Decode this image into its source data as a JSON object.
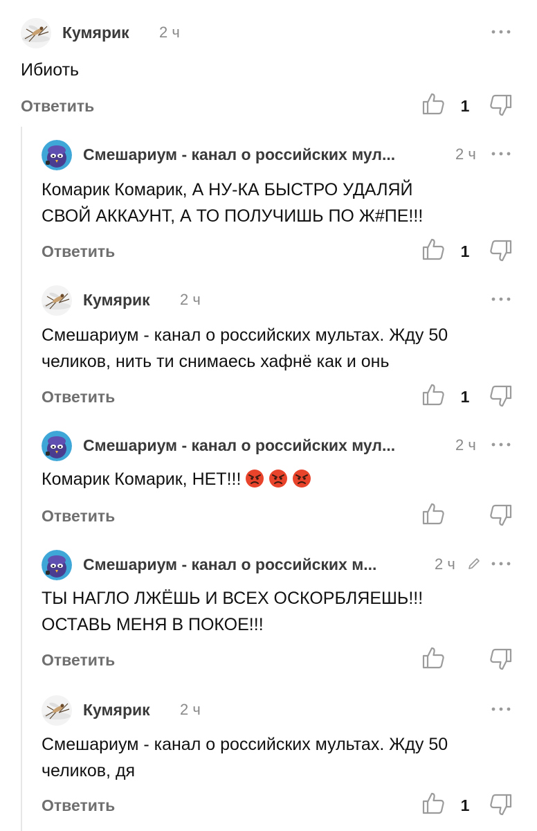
{
  "comments": [
    {
      "author": "Кумярик",
      "time": "2 ч",
      "text": "Ибиоть",
      "reply_label": "Ответить",
      "likes": "1"
    },
    {
      "author": "Смешариум - канал о российских мул...",
      "time": "2 ч",
      "text_lines": [
        "Комарик Комарик, А НУ-КА БЫСТРО УДАЛЯЙ",
        "СВОЙ АККАУНТ, А ТО ПОЛУЧИШЬ ПО Ж#ПЕ!!!"
      ],
      "reply_label": "Ответить",
      "likes": "1"
    },
    {
      "author": "Кумярик",
      "time": "2 ч",
      "text_lines": [
        "Смешариум - канал о российских мультах. Жду 50",
        "челиков, нить ти снимаесь хафнё как и онь"
      ],
      "reply_label": "Ответить",
      "likes": "1"
    },
    {
      "author": "Смешариум - канал о российских мул...",
      "time": "2 ч",
      "text": "Комарик Комарик, НЕТ!!!",
      "emojis": [
        "angry-face",
        "angry-face",
        "angry-face"
      ],
      "reply_label": "Ответить",
      "likes": ""
    },
    {
      "author": "Смешариум - канал о российских м...",
      "time": "2 ч",
      "edited_icon": "pencil-icon",
      "text_lines": [
        "ТЫ НАГЛО ЛЖЁШЬ И ВСЕХ ОСКОРБЛЯЕШЬ!!!",
        "ОСТАВЬ МЕНЯ В ПОКОЕ!!!"
      ],
      "reply_label": "Ответить",
      "likes": ""
    },
    {
      "author": "Кумярик",
      "time": "2 ч",
      "text_lines": [
        "Смешариум - канал о российских мультах. Жду 50",
        "челиков, дя"
      ],
      "reply_label": "Ответить",
      "likes": "1"
    }
  ],
  "colors": {
    "author": "#3a3a3a",
    "meta": "#8a8a8a",
    "reply": "#6f6f6f",
    "thread_line": "#e6e6e6",
    "angry_emoji": "#e8442c"
  }
}
